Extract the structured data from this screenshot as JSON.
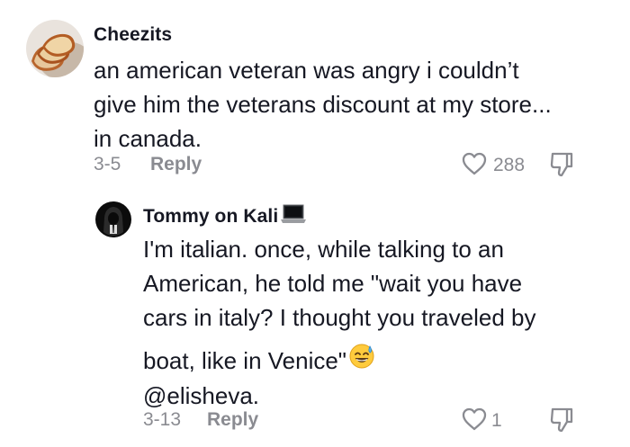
{
  "comment": {
    "username": "Cheezits",
    "text_lines": [
      "an american veteran was angry i couldn’t",
      "give him the veterans discount at my store...",
      "in canada."
    ],
    "date": "3-5",
    "reply_label": "Reply",
    "like_count": "288",
    "avatar_icon": "bread-slices-avatar"
  },
  "reply": {
    "username": "Tommy on Kali",
    "username_suffix_icon": "laptop-icon",
    "text_lines": [
      "I'm italian. once, while talking to an",
      "American, he told me \"wait you have",
      "cars in italy? I thought you traveled by",
      "boat, like in Venice\"",
      "@elisheva."
    ],
    "emoji_icon": "sweat-smile-emoji",
    "date": "3-13",
    "reply_label": "Reply",
    "like_count": "1",
    "avatar_icon": "hooded-figure-avatar"
  },
  "colors": {
    "text": "#161823",
    "muted": "#8a8b91"
  }
}
